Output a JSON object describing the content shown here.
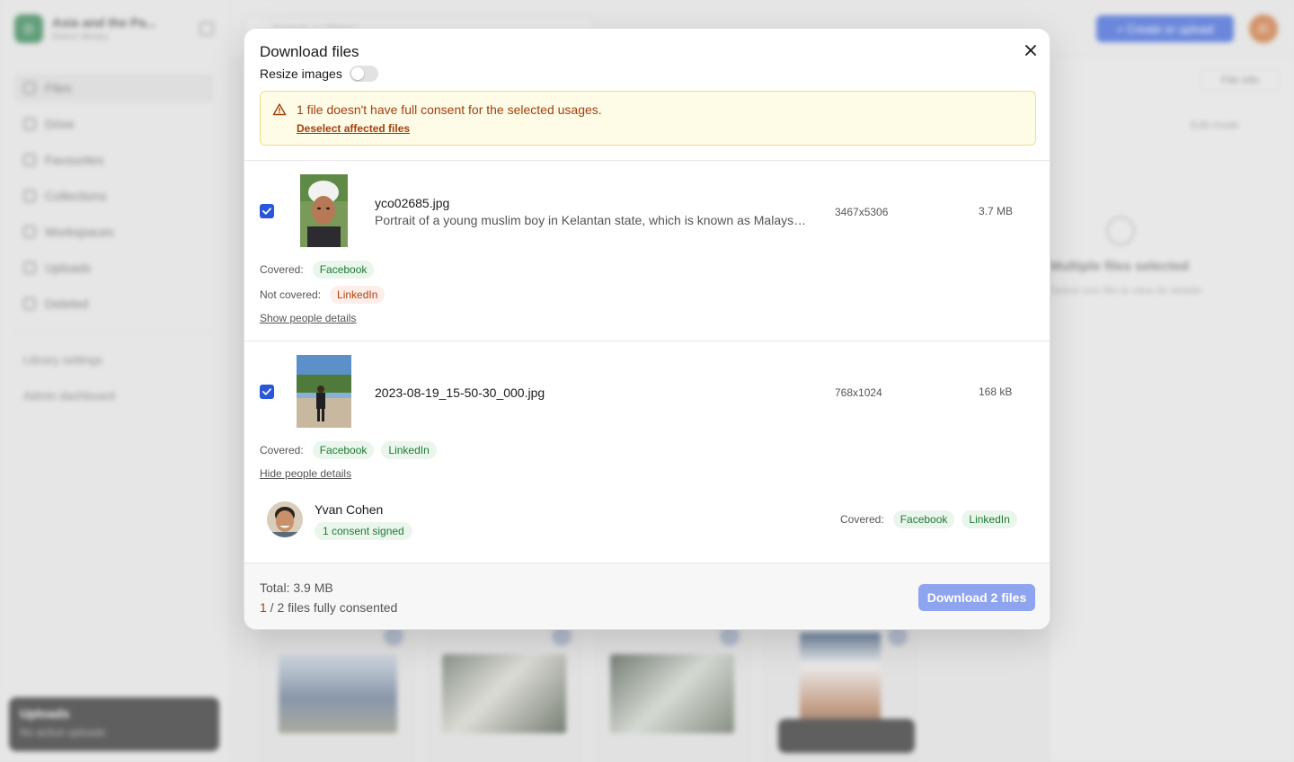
{
  "background": {
    "library_name": "Asia and the Pa...",
    "library_sub": "Demo library",
    "library_initial": "D",
    "nav": [
      "Files",
      "Drive",
      "Favourites",
      "Collections",
      "Workspaces",
      "Uploads",
      "Deleted"
    ],
    "library_settings": "Library settings",
    "admin_dashboard": "Admin dashboard",
    "uploads_title": "Uploads",
    "uploads_sub": "No active uploads",
    "search_placeholder": "Search in \"Files\"",
    "create_button": "+ Create or upload",
    "avatar_initials": "JC",
    "file_info": "File info",
    "edit_mode": "Edit mode",
    "multi_title": "Multiple files selected",
    "multi_sub": "Select one file to view its details"
  },
  "modal": {
    "title": "Download files",
    "resize_label": "Resize images",
    "resize_enabled": false,
    "warning_text": "1 file doesn't have full consent for the selected usages.",
    "warning_link": "Deselect affected files",
    "files": [
      {
        "checked": true,
        "name": "yco02685.jpg",
        "description": "Portrait of a young muslim boy in Kelantan state, which is known as Malaysia's most conservative state",
        "dimensions": "3467x5306",
        "size": "3.7 MB",
        "covered_label": "Covered:",
        "covered": [
          "Facebook"
        ],
        "not_covered_label": "Not covered:",
        "not_covered": [
          "LinkedIn"
        ],
        "people_link": "Show people details"
      },
      {
        "checked": true,
        "name": "2023-08-19_15-50-30_000.jpg",
        "dimensions": "768x1024",
        "size": "168 kB",
        "covered_label": "Covered:",
        "covered": [
          "Facebook",
          "LinkedIn"
        ],
        "people_link": "Hide people details",
        "person": {
          "name": "Yvan Cohen",
          "badge": "1 consent signed",
          "covered_label": "Covered:",
          "covered": [
            "Facebook",
            "LinkedIn"
          ]
        }
      }
    ],
    "footer": {
      "total": "Total: 3.9 MB",
      "consented_count": "1",
      "consented_rest": " / 2 files fully consented",
      "download_button": "Download 2 files"
    }
  },
  "colors": {
    "primary": "#2a57d9",
    "primary_disabled": "#8fa4ee",
    "warning_bg": "#fefbe6",
    "warning_text": "#a0400f",
    "covered_bg": "#eaf6ec",
    "covered_text": "#1f7a34",
    "not_covered_bg": "#fdeeea",
    "not_covered_text": "#b4400e"
  },
  "icons": {
    "close": "close-icon",
    "warning": "warning-triangle-icon",
    "checkbox": "check-icon"
  }
}
